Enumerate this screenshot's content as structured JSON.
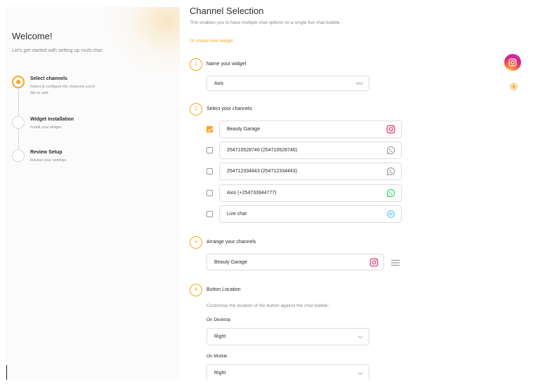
{
  "sidebar": {
    "title": "Welcome!",
    "subtitle": "Let's get started with setting up multi chat.",
    "steps": [
      {
        "title": "Select channels",
        "desc": "Select & configure the channels you'd like to add.",
        "active": true
      },
      {
        "title": "Widget Installation",
        "desc": "Install your widget.",
        "active": false
      },
      {
        "title": "Review Setup",
        "desc": "Review your settings.",
        "active": false
      }
    ]
  },
  "main": {
    "title": "Channel Selection",
    "subtitle": "This enables you to have multiple chat options on a single live chat bubble.",
    "create_link": "Or create new widget",
    "sections": [
      {
        "num": "1",
        "label": "Name your widget"
      },
      {
        "num": "2",
        "label": "Select your channels"
      },
      {
        "num": "3",
        "label": "Arrange your channels"
      },
      {
        "num": "4",
        "label": "Button Location"
      }
    ],
    "widget_name": {
      "value": "Axis",
      "counter": "4/60"
    },
    "channels": [
      {
        "name": "Beauty Garage",
        "checked": true,
        "icon": "instagram-icon"
      },
      {
        "name": "254710528746 (254710528746)",
        "checked": false,
        "icon": "whatsapp-outline-icon"
      },
      {
        "name": "254712334443 (254712334443)",
        "checked": false,
        "icon": "whatsapp-outline-icon"
      },
      {
        "name": "Axis (+254733944777)",
        "checked": false,
        "icon": "whatsapp-green-icon"
      },
      {
        "name": "Live chat",
        "checked": false,
        "icon": "live-chat-icon"
      }
    ],
    "arranged": [
      {
        "name": "Beauty Garage",
        "icon": "instagram-icon"
      }
    ],
    "location": {
      "hint": "Customise the location of the button against the chat bubble:",
      "desktop_label": "On Desktop",
      "desktop_value": "Right",
      "mobile_label": "On Mobile",
      "mobile_value": "Right"
    }
  },
  "colors": {
    "accent": "#f6a623",
    "whatsapp": "#25d366",
    "live_chat": "#4fc3f7",
    "instagram": "#e1306c"
  }
}
